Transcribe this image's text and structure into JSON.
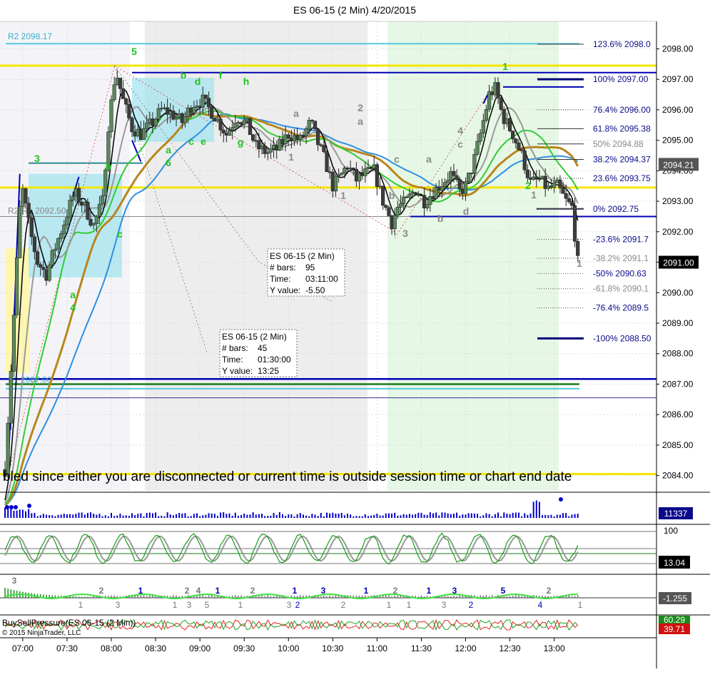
{
  "title": "ES 06-15 (2 Min)  4/20/2015",
  "banner": "bled since either you are disconnected or current time is outside session time or chart end date",
  "copyright": "© 2015 NinjaTrader, LLC",
  "colors": {
    "background": "#ffffff",
    "up_candle": "#5b8a5b",
    "down_candle": "#3d3d3d",
    "yellow": "#f5e600",
    "blue": "#0000b4",
    "cyan": "#56c8e0",
    "sma_black": "#000000",
    "sma_gray": "#999999",
    "sma_gold": "#b8861b",
    "sma_green": "#33cc33",
    "sma_blue": "#2e8fe0"
  },
  "chart_data": {
    "type": "candlestick",
    "symbol": "ES 06-15 (2 Min)",
    "date": "4/20/2015",
    "ylim": [
      2083.5,
      2098.9
    ],
    "y_ticks": [
      "2098.00",
      "2097.00",
      "2096.00",
      "2095.00",
      "2094.00",
      "2093.00",
      "2092.00",
      "2091.00",
      "2090.00",
      "2089.00",
      "2088.00",
      "2087.00",
      "2086.00",
      "2085.00",
      "2084.00"
    ],
    "x_ticks": [
      "07:00",
      "07:30",
      "08:00",
      "08:30",
      "09:00",
      "09:30",
      "10:00",
      "10:30",
      "11:00",
      "11:30",
      "12:00",
      "12:30",
      "13:00"
    ],
    "price_badges": [
      {
        "value": "2094.21",
        "bg": "#555555"
      },
      {
        "value": "2091.00",
        "bg": "#000000"
      }
    ],
    "pivots": [
      {
        "label": "R2 2098.17",
        "value": 2098.17
      },
      {
        "label": "R2-R1 2092.50",
        "value": 2092.5
      },
      {
        "label": "S1 2087.00",
        "value": 2087.0
      }
    ],
    "fib_levels": [
      {
        "label": "123.6%",
        "value": "2098.0",
        "price": 2098.15
      },
      {
        "label": "100%",
        "value": "2097.00",
        "price": 2097.0
      },
      {
        "label": "76.4%",
        "value": "2096.00",
        "price": 2096.0
      },
      {
        "label": "61.8%",
        "value": "2095.38",
        "price": 2095.38
      },
      {
        "label": "50%",
        "value": "2094.88",
        "price": 2094.88
      },
      {
        "label": "38.2%",
        "value": "2094.37",
        "price": 2094.37
      },
      {
        "label": "23.6%",
        "value": "2093.75",
        "price": 2093.75
      },
      {
        "label": "0%",
        "value": "2092.75",
        "price": 2092.75
      },
      {
        "label": "-23.6%",
        "value": "2091.7",
        "price": 2091.75
      },
      {
        "label": "-38.2%",
        "value": "2091.1",
        "price": 2091.13
      },
      {
        "label": "-50%",
        "value": "2090.63",
        "price": 2090.63
      },
      {
        "label": "-61.8%",
        "value": "2090.1",
        "price": 2090.13
      },
      {
        "label": "-76.4%",
        "value": "2089.5",
        "price": 2089.5
      },
      {
        "label": "-100%",
        "value": "2088.50",
        "price": 2088.5
      }
    ],
    "tooltips": [
      {
        "title": "ES 06-15 (2 Min)",
        "bars_label": "# bars:",
        "bars": "95",
        "time_label": "Time:",
        "time": "03:11:00",
        "y_label": "Y value:",
        "y": "-5.50"
      },
      {
        "title": "ES 06-15 (2 Min)",
        "bars_label": "# bars:",
        "bars": "45",
        "time_label": "Time:",
        "time": "01:30:00",
        "y_label": "Y value:",
        "y": "13:25"
      }
    ],
    "wave_labels_green": [
      "5",
      "3",
      "a",
      "4",
      "b",
      "c",
      "b",
      "d",
      "c",
      "e",
      "a",
      "6",
      "f",
      "g",
      "h",
      "1",
      "2"
    ],
    "wave_labels_gray": [
      "2",
      "a",
      "a",
      "1",
      "1",
      "c",
      "a",
      "b",
      "3",
      "b",
      "d",
      "4",
      "c",
      "1",
      "1"
    ],
    "volume_value": "11337",
    "stoch_top": "100",
    "stoch_value": "13.04",
    "wave_osc_value": "-1.255",
    "wave_osc_labels_top": [
      "3",
      "2",
      "1",
      "2",
      "4",
      "1",
      "2",
      "1",
      "3",
      "1",
      "2",
      "1",
      "3",
      "5",
      "2"
    ],
    "wave_osc_labels_bottom": [
      "1",
      "3",
      "1",
      "3",
      "5",
      "1",
      "3",
      "2",
      "1",
      "1",
      "3",
      "2",
      "4",
      "1",
      "2"
    ],
    "bsp_label": "BuySellPressure(ES 06-15 (2 Min))",
    "bsp_values": [
      "60.29",
      "39.71"
    ]
  }
}
